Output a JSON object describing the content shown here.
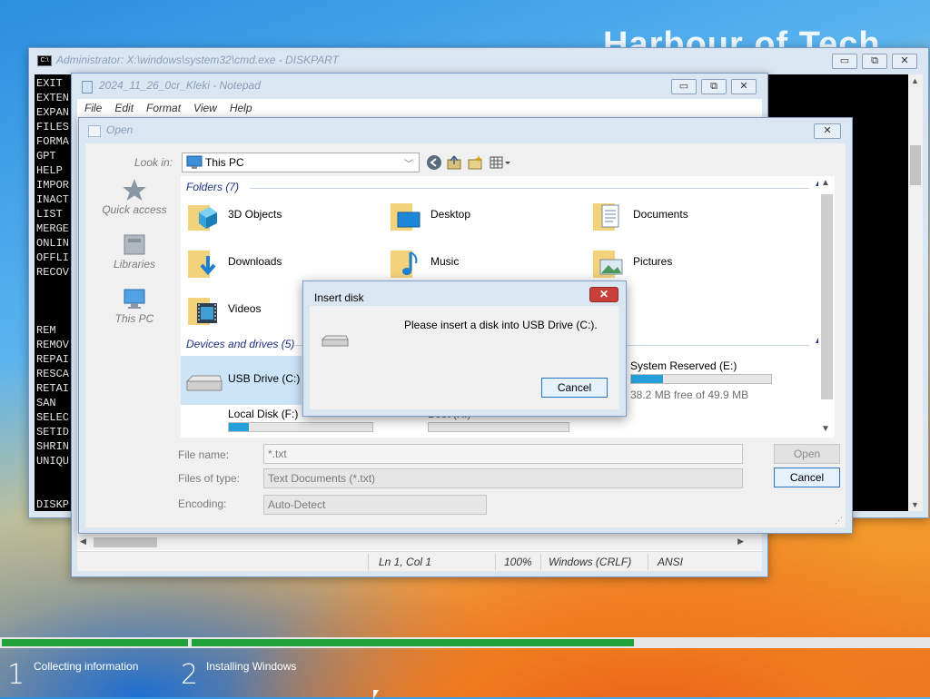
{
  "watermark": "Harbour of Tech",
  "cmd": {
    "title": "Administrator: X:\\windows\\system32\\cmd.exe - DISKPART",
    "lines": [
      "EXIT",
      "EXTEN",
      "EXPAN",
      "FILES",
      "FORMA",
      "GPT",
      "HELP",
      "IMPOR",
      "INACT",
      "LIST",
      "MERGE",
      "ONLIN",
      "OFFLI",
      "RECOV",
      "",
      "",
      "",
      "REM",
      "REMOV",
      "REPAI",
      "RESCA",
      "RETAI",
      "SAN",
      "SELEC",
      "SETID",
      "SHRIN",
      "UNIQU",
      "",
      "",
      "DISKP"
    ],
    "min": "▭",
    "max": "⧉",
    "close": "✕"
  },
  "notepad": {
    "title": "2024_11_26_0cr_Kleki - Notepad",
    "menu": [
      "File",
      "Edit",
      "Format",
      "View",
      "Help"
    ],
    "status": {
      "pos": "Ln 1, Col 1",
      "zoom": "100%",
      "eol": "Windows (CRLF)",
      "enc": "ANSI"
    },
    "scroll_left": "◀",
    "scroll_right": "▶",
    "min": "▭",
    "max": "⧉",
    "close": "✕"
  },
  "open": {
    "title": "Open",
    "close": "✕",
    "look_in_label": "Look in:",
    "look_in_value": "This PC",
    "nav": [
      "Quick access",
      "Libraries",
      "This PC"
    ],
    "folders_header": "Folders (7)",
    "folders": [
      "3D Objects",
      "Desktop",
      "Documents",
      "Downloads",
      "Music",
      "Pictures",
      "Videos"
    ],
    "devices_header": "Devices and drives (5)",
    "drives": {
      "usb": {
        "label": "USB Drive (C:)"
      },
      "sysres": {
        "label": "System Reserved (E:)",
        "free": "38.2 MB free of 49.9 MB",
        "used_fraction": 0.23
      },
      "local": {
        "label": "Local Disk (F:)",
        "used_fraction": 0.14
      },
      "boot": {
        "label": "Boot (X:)",
        "used_fraction": 0.0
      }
    },
    "file_name_label": "File name:",
    "file_name_value": "*.txt",
    "file_type_label": "Files of type:",
    "file_type_value": "Text Documents (*.txt)",
    "encoding_label": "Encoding:",
    "encoding_value": "Auto-Detect",
    "open_btn": "Open",
    "cancel_btn": "Cancel"
  },
  "insert": {
    "title": "Insert disk",
    "message": "Please insert a disk into USB Drive (C:).",
    "cancel": "Cancel",
    "close": "✕"
  },
  "setup": {
    "step1_num": "1",
    "step1_label": "Collecting information",
    "step2_num": "2",
    "step2_label": "Installing Windows",
    "step1_progress": 1.0,
    "step2_progress": 0.6,
    "colors": {
      "progress": "#1fa33a",
      "track": "#e6e6e6"
    }
  }
}
